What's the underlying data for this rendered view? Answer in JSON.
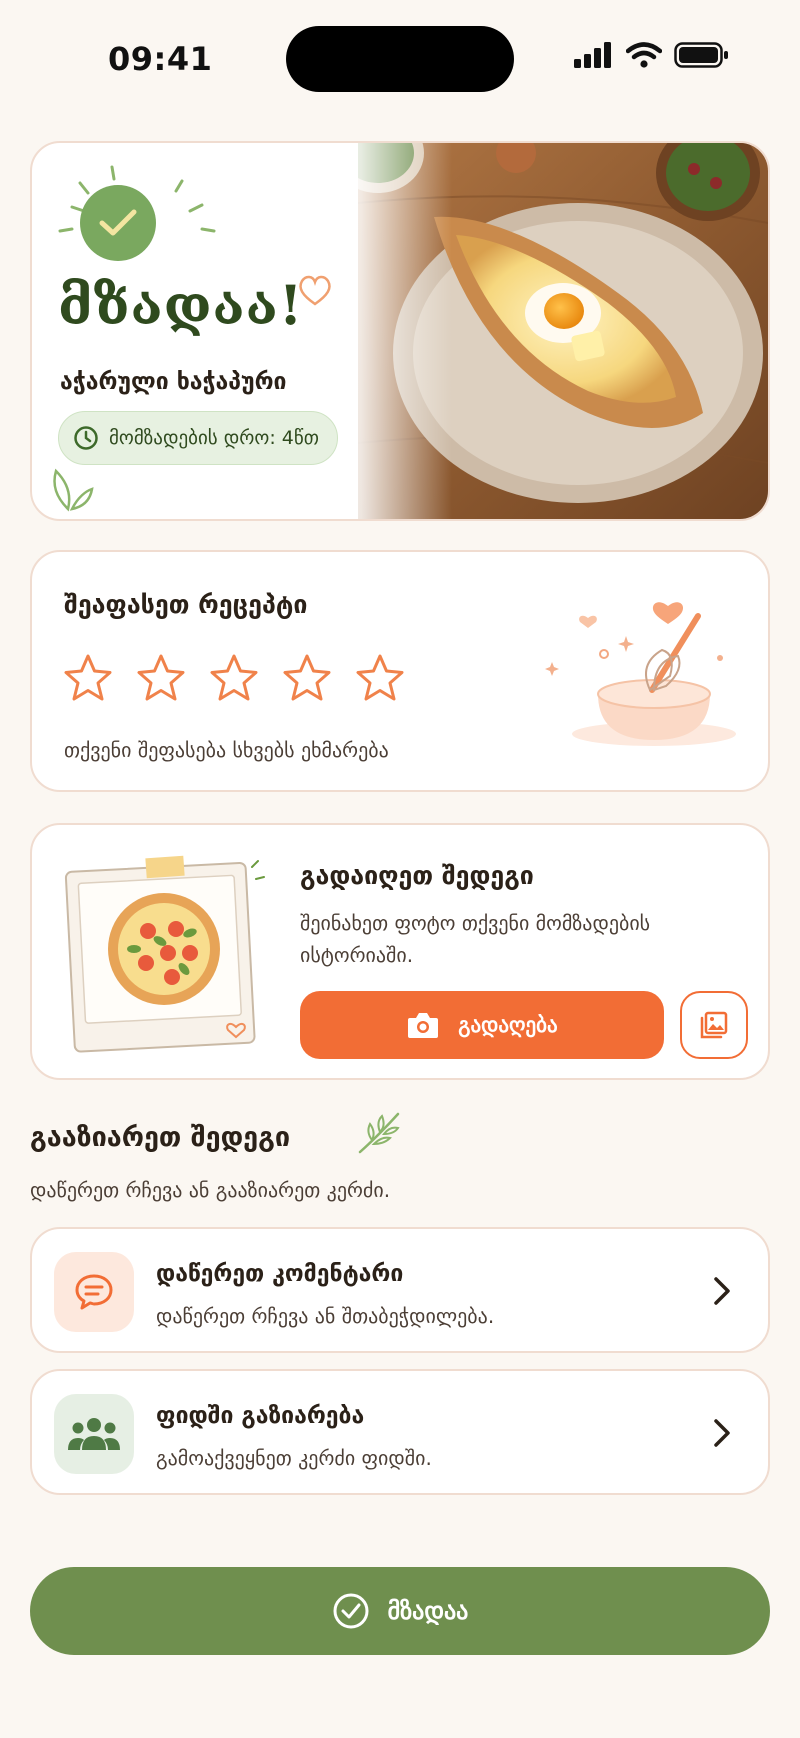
{
  "status_bar": {
    "time": "09:41"
  },
  "hero": {
    "title": "მზადაა!",
    "dish_name": "აჭარული ხაჭაპური",
    "prep_time": "მომზადების დრო: 4წთ"
  },
  "rating": {
    "title": "შეაფასეთ რეცეპტი",
    "max_stars": 5,
    "selected_stars": 0,
    "hint": "თქვენი შეფასება სხვებს ეხმარება"
  },
  "photo": {
    "title": "გადაიღეთ შედეგი",
    "description": "შეინახეთ ფოტო თქვენი მომზადების ისტორიაში.",
    "shoot_label": "გადაღება"
  },
  "share": {
    "title": "გააზიარეთ შედეგი",
    "subtitle": "დაწერეთ რჩევა ან გააზიარეთ კერძი.",
    "items": [
      {
        "icon": "comment-icon",
        "title": "დაწერეთ კომენტარი",
        "subtitle": "დაწერეთ რჩევა ან შთაბეჭდილება."
      },
      {
        "icon": "group-icon",
        "title": "ფიდში გაზიარება",
        "subtitle": "გამოაქვეყნეთ კერძი ფიდში."
      }
    ]
  },
  "footer": {
    "done_label": "მზადაა"
  },
  "colors": {
    "accent": "#f26d35",
    "green": "#6f8f4e",
    "background": "#fbf7f2"
  }
}
